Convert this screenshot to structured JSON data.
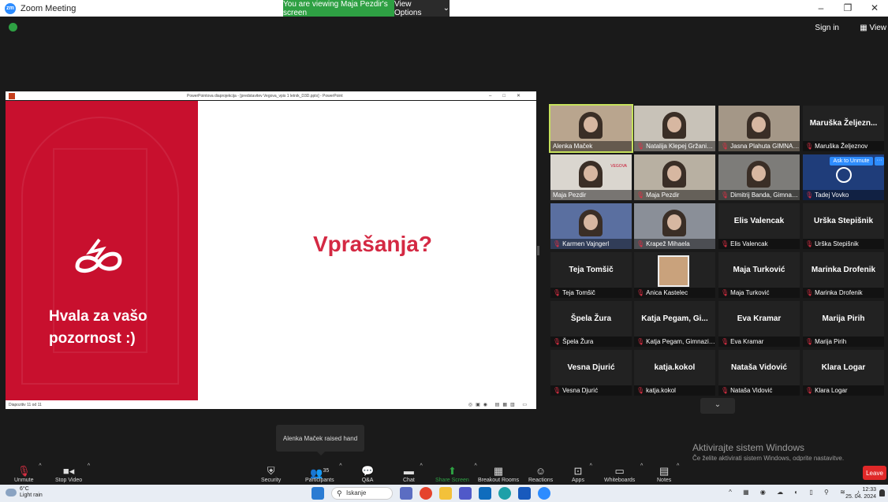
{
  "window": {
    "title": "Zoom Meeting",
    "controls": [
      "–",
      "❐",
      "✕"
    ]
  },
  "banner": {
    "viewing": "You are viewing Maja Pezdir's screen",
    "view_options": "View Options"
  },
  "top_right": {
    "sign_in": "Sign in",
    "view": "View"
  },
  "ppt": {
    "title": "PowerPointova diaprojekcija - [predstavitev Vegova_vpis 1 letnik_D3D.pptx] - PowerPoint",
    "status": "Diapozitiv 11 od 11",
    "left_text_line1": "Hvala za vašo",
    "left_text_line2": "pozornost :)",
    "question": "Vprašanja?",
    "brand_color": "#c8102e"
  },
  "gallery": {
    "tiles": [
      {
        "name": "Alenka Maček",
        "muted": false,
        "video": true,
        "big": ""
      },
      {
        "name": "Natalija Klepej Gržanič, ...",
        "muted": true,
        "video": true,
        "big": ""
      },
      {
        "name": "Jasna Plahuta GIMNAZIJ...",
        "muted": true,
        "video": true,
        "big": ""
      },
      {
        "name": "Maruška Željeznov",
        "muted": true,
        "video": false,
        "big": "Maruška Željezn..."
      },
      {
        "name": "Maja Pezdir",
        "muted": false,
        "video": true,
        "big": ""
      },
      {
        "name": "Maja Pezdir",
        "muted": true,
        "video": true,
        "big": ""
      },
      {
        "name": "Dimitrij Banda, Gimnazij...",
        "muted": true,
        "video": true,
        "big": ""
      },
      {
        "name": "Tadej Vovko",
        "muted": true,
        "video": false,
        "big": ""
      },
      {
        "name": "Karmen Vajngerl",
        "muted": true,
        "video": true,
        "big": ""
      },
      {
        "name": "Krapež Mihaela",
        "muted": true,
        "video": true,
        "big": ""
      },
      {
        "name": "Elis Valencak",
        "muted": true,
        "video": false,
        "big": "Elis Valencak"
      },
      {
        "name": "Urška Stepišnik",
        "muted": true,
        "video": false,
        "big": "Urška Stepišnik"
      },
      {
        "name": "Teja Tomšič",
        "muted": true,
        "video": false,
        "big": "Teja Tomšič"
      },
      {
        "name": "Anica Kastelec",
        "muted": true,
        "video": false,
        "big": ""
      },
      {
        "name": "Maja Turković",
        "muted": true,
        "video": false,
        "big": "Maja Turković"
      },
      {
        "name": "Marinka Drofenik",
        "muted": true,
        "video": false,
        "big": "Marinka Drofenik"
      },
      {
        "name": "Špela Žura",
        "muted": true,
        "video": false,
        "big": "Špela Žura"
      },
      {
        "name": "Katja Pegam, Gimnazija ...",
        "muted": true,
        "video": false,
        "big": "Katja Pegam, Gi..."
      },
      {
        "name": "Eva Kramar",
        "muted": true,
        "video": false,
        "big": "Eva Kramar"
      },
      {
        "name": "Marija Pirih",
        "muted": true,
        "video": false,
        "big": "Marija Pirih"
      },
      {
        "name": "Vesna Djurić",
        "muted": true,
        "video": false,
        "big": "Vesna Djurić"
      },
      {
        "name": "katja.kokol",
        "muted": true,
        "video": false,
        "big": "katja.kokol"
      },
      {
        "name": "Nataša Vidović",
        "muted": true,
        "video": false,
        "big": "Nataša Vidović"
      },
      {
        "name": "Klara Logar",
        "muted": true,
        "video": false,
        "big": "Klara Logar"
      }
    ],
    "ask_to_unmute": "Ask to Unmute",
    "ask_more": "···",
    "vegova": "VEGOVA",
    "more_chevron": "⌄"
  },
  "notification": "Alenka Maček raised hand",
  "activate": {
    "line1": "Aktivirajte sistem Windows",
    "line2": "Če želite aktivirati sistem Windows, odprite nastavitve."
  },
  "toolbar": {
    "unmute": "Unmute",
    "stop_video": "Stop Video",
    "security": "Security",
    "participants": "Participants",
    "participants_count": "35",
    "qa": "Q&A",
    "chat": "Chat",
    "share_screen": "Share Screen",
    "breakout": "Breakout Rooms",
    "reactions": "Reactions",
    "apps": "Apps",
    "whiteboards": "Whiteboards",
    "notes": "Notes",
    "leave": "Leave"
  },
  "taskbar": {
    "temp": "6°C",
    "weather": "Light rain",
    "search": "Iskanje",
    "time": "12:33",
    "date": "25. 04. 2024"
  }
}
